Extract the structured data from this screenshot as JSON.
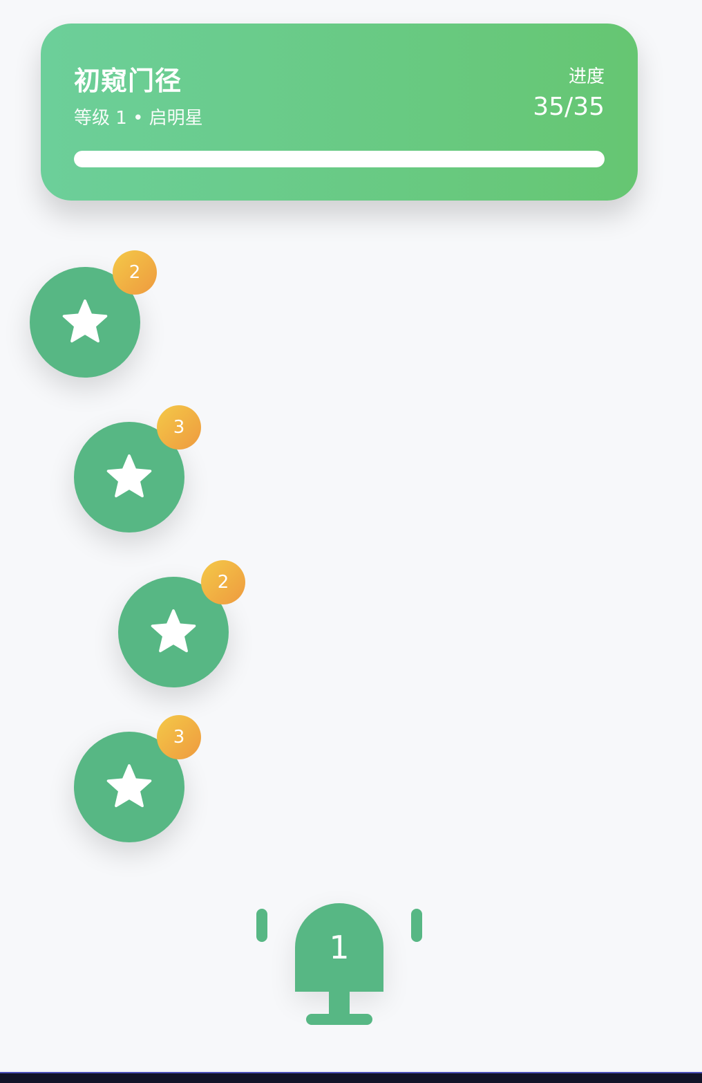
{
  "header": {
    "title": "初窥门径",
    "subtitle": "等级 1 • 启明星",
    "progress_label": "进度",
    "progress_value": "35/35",
    "progress_fraction": 1.0
  },
  "nodes": [
    {
      "icon": "star-icon",
      "badge": "2",
      "color": "#57b784"
    },
    {
      "icon": "star-icon",
      "badge": "3",
      "color": "#57b784"
    },
    {
      "icon": "star-icon",
      "badge": "2",
      "color": "#57b784"
    },
    {
      "icon": "star-icon",
      "badge": "3",
      "color": "#57b784"
    }
  ],
  "checkpoint": {
    "label": "1"
  },
  "colors": {
    "header_gradient_start": "#6ccf9a",
    "header_gradient_end": "#66c672",
    "node": "#57b784",
    "badge_start": "#f4c948",
    "badge_end": "#ee9a3f",
    "background": "#f7f8fa"
  }
}
